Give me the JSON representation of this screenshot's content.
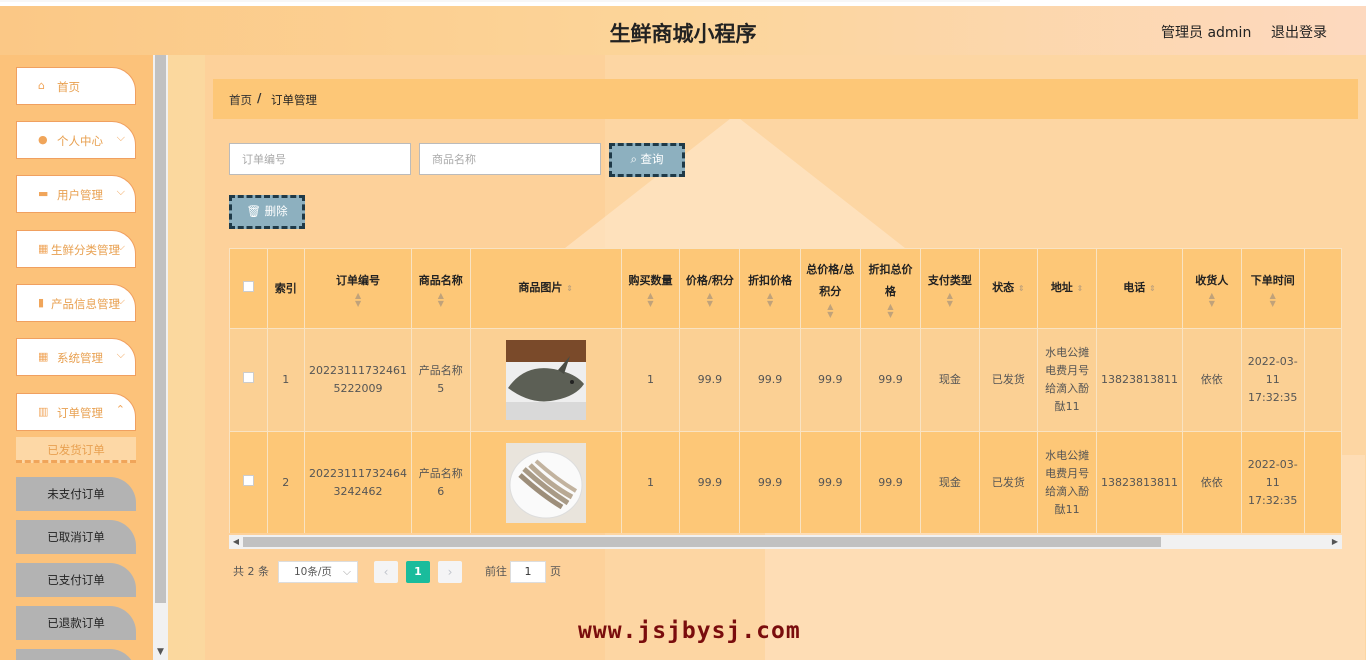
{
  "header": {
    "title": "生鲜商城小程序",
    "user": "管理员 admin",
    "logout": "退出登录"
  },
  "sidebar": {
    "items": [
      {
        "label": "首页",
        "icon": "home-icon",
        "has_children": false
      },
      {
        "label": "个人中心",
        "icon": "user-icon",
        "has_children": true
      },
      {
        "label": "用户管理",
        "icon": "briefcase-icon",
        "has_children": true
      },
      {
        "label": "生鲜分类管理",
        "icon": "grid-icon",
        "has_children": true
      },
      {
        "label": "产品信息管理",
        "icon": "trash-icon",
        "has_children": true
      },
      {
        "label": "系统管理",
        "icon": "grid-icon",
        "has_children": true
      },
      {
        "label": "订单管理",
        "icon": "chart-icon",
        "has_children": true
      }
    ],
    "sub_active": "已发货订单",
    "sub_items": [
      "未支付订单",
      "已取消订单",
      "已支付订单",
      "已退款订单"
    ]
  },
  "breadcrumb": {
    "home": "首页",
    "separator": "/",
    "current": "订单管理"
  },
  "search": {
    "order_no_placeholder": "订单编号",
    "product_name_placeholder": "商品名称",
    "query_label": "查询"
  },
  "toolbar": {
    "delete_label": "删除"
  },
  "table": {
    "headers": [
      "索引",
      "订单编号",
      "商品名称",
      "商品图片",
      "购买数量",
      "价格/积分",
      "折扣价格",
      "总价格/总积分",
      "折扣总价格",
      "支付类型",
      "状态",
      "地址",
      "电话",
      "收货人",
      "下单时间"
    ],
    "rows": [
      {
        "index": "1",
        "order_no": "20223111732461 5222009",
        "product_name": "产品名称5",
        "image": "fish-photo",
        "quantity": "1",
        "price": "99.9",
        "discount_price": "99.9",
        "total_price": "99.9",
        "discount_total": "99.9",
        "pay_type": "现金",
        "status": "已发货",
        "address": "水电公摊电费月号给滴入酚酞11",
        "phone": "13823813811",
        "receiver": "依依",
        "order_time": "2022-03-11 17:32:35"
      },
      {
        "index": "2",
        "order_no": "20223111732464 3242462",
        "product_name": "产品名称6",
        "image": "shrimp-photo",
        "quantity": "1",
        "price": "99.9",
        "discount_price": "99.9",
        "total_price": "99.9",
        "discount_total": "99.9",
        "pay_type": "现金",
        "status": "已发货",
        "address": "水电公摊电费月号给滴入酚酞11",
        "phone": "13823813811",
        "receiver": "依依",
        "order_time": "2022-03-11 17:32:35"
      }
    ]
  },
  "pagination": {
    "total": "共 2 条",
    "page_size": "10条/页",
    "current_page": "1",
    "goto_label": "前往",
    "goto_value": "1",
    "page_unit": "页"
  },
  "watermark": "www.jsjbysj.com",
  "colors": {
    "accent": "#fdc777",
    "page_active": "#1abc9c",
    "button": "#8db0bf"
  }
}
